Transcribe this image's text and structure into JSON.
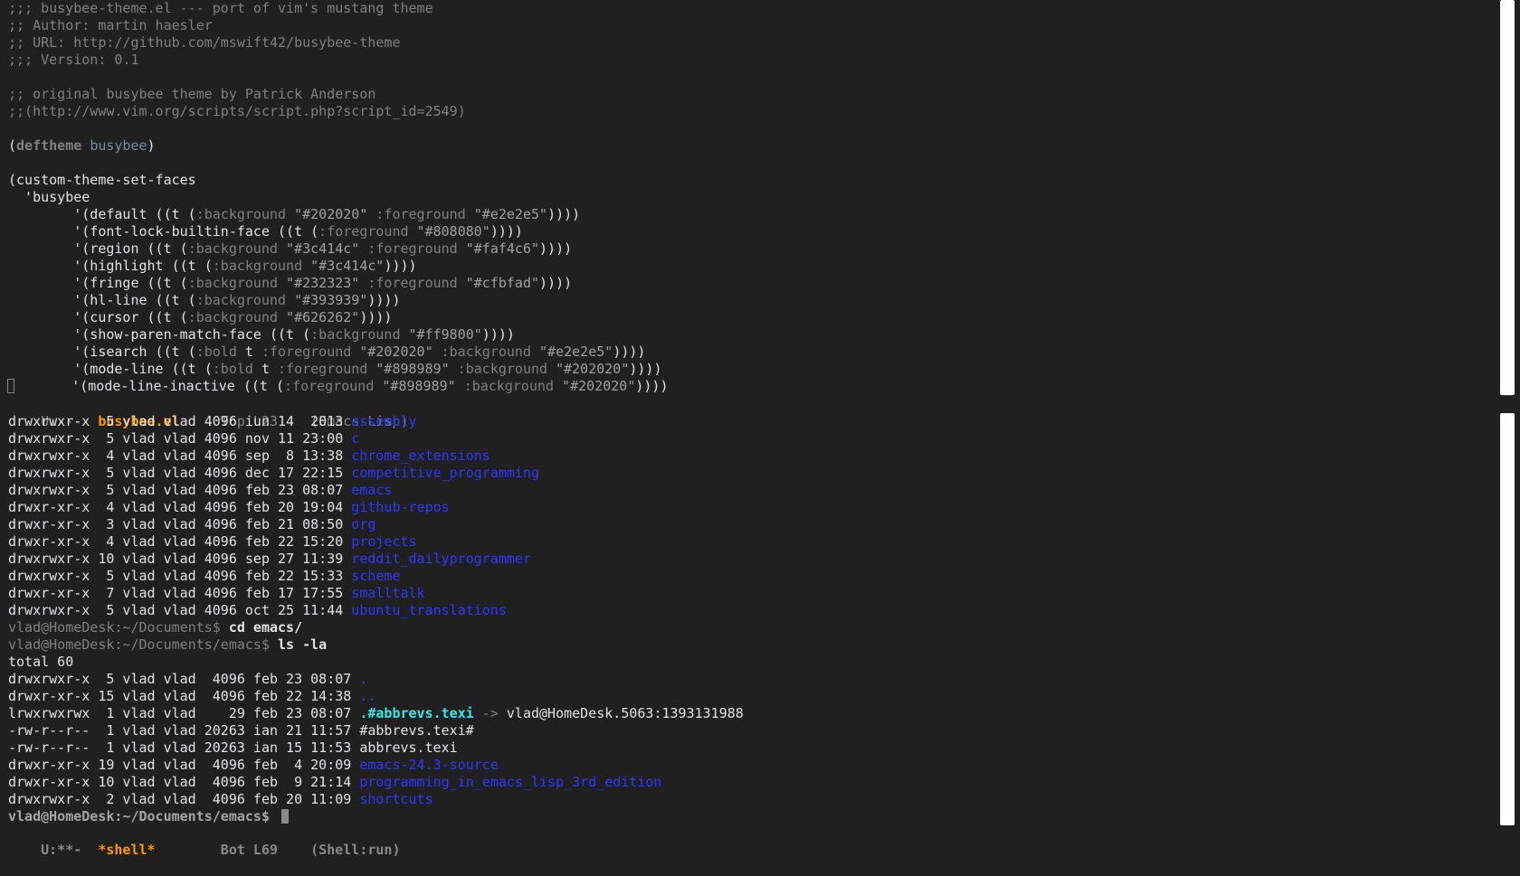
{
  "editor": {
    "lines": [
      [
        {
          "t": ";;; busybee-theme.el --- port of vim's mustang theme",
          "c": "c-comment"
        }
      ],
      [
        {
          "t": ";; Author: martin haesler",
          "c": "c-comment"
        }
      ],
      [
        {
          "t": ";; URL: http://github.com/mswift42/busybee-theme",
          "c": "c-comment"
        }
      ],
      [
        {
          "t": ";;; Version: 0.1",
          "c": "c-comment"
        }
      ],
      [
        {
          "t": ""
        }
      ],
      [
        {
          "t": ";; original busybee theme by Patrick Anderson",
          "c": "c-comment"
        }
      ],
      [
        {
          "t": ";;(http://www.vim.org/scripts/script.php?script_id=2549)",
          "c": "c-comment"
        }
      ],
      [
        {
          "t": ""
        }
      ],
      [
        {
          "t": "("
        },
        {
          "t": "deftheme",
          "c": "c-kw"
        },
        {
          "t": " "
        },
        {
          "t": "busybee",
          "c": "c-type"
        },
        {
          "t": ")"
        }
      ],
      [
        {
          "t": ""
        }
      ],
      [
        {
          "t": "(custom-theme-set-faces"
        }
      ],
      [
        {
          "t": "  'busybee"
        }
      ],
      [
        {
          "t": "        '(default ((t ("
        },
        {
          "t": ":background",
          "c": "c-key"
        },
        {
          "t": " "
        },
        {
          "t": "\"#202020\"",
          "c": "c-str"
        },
        {
          "t": " "
        },
        {
          "t": ":foreground",
          "c": "c-key"
        },
        {
          "t": " "
        },
        {
          "t": "\"#e2e2e5\"",
          "c": "c-str"
        },
        {
          "t": "))))"
        }
      ],
      [
        {
          "t": "        '(font-lock-builtin-face ((t ("
        },
        {
          "t": ":foreground",
          "c": "c-key"
        },
        {
          "t": " "
        },
        {
          "t": "\"#808080\"",
          "c": "c-str"
        },
        {
          "t": "))))"
        }
      ],
      [
        {
          "t": "        '(region ((t ("
        },
        {
          "t": ":background",
          "c": "c-key"
        },
        {
          "t": " "
        },
        {
          "t": "\"#3c414c\"",
          "c": "c-str"
        },
        {
          "t": " "
        },
        {
          "t": ":foreground",
          "c": "c-key"
        },
        {
          "t": " "
        },
        {
          "t": "\"#faf4c6\"",
          "c": "c-str"
        },
        {
          "t": "))))"
        }
      ],
      [
        {
          "t": "        '(highlight ((t ("
        },
        {
          "t": ":background",
          "c": "c-key"
        },
        {
          "t": " "
        },
        {
          "t": "\"#3c414c\"",
          "c": "c-str"
        },
        {
          "t": "))))"
        }
      ],
      [
        {
          "t": "        '(fringe ((t ("
        },
        {
          "t": ":background",
          "c": "c-key"
        },
        {
          "t": " "
        },
        {
          "t": "\"#232323\"",
          "c": "c-str"
        },
        {
          "t": " "
        },
        {
          "t": ":foreground",
          "c": "c-key"
        },
        {
          "t": " "
        },
        {
          "t": "\"#cfbfad\"",
          "c": "c-str"
        },
        {
          "t": "))))"
        }
      ],
      [
        {
          "t": "        '(hl-line ((t ("
        },
        {
          "t": ":background",
          "c": "c-key"
        },
        {
          "t": " "
        },
        {
          "t": "\"#393939\"",
          "c": "c-str"
        },
        {
          "t": "))))"
        }
      ],
      [
        {
          "t": "        '(cursor ((t ("
        },
        {
          "t": ":background",
          "c": "c-key"
        },
        {
          "t": " "
        },
        {
          "t": "\"#626262\"",
          "c": "c-str"
        },
        {
          "t": "))))"
        }
      ],
      [
        {
          "t": "        '(show-paren-match-face ((t ("
        },
        {
          "t": ":background",
          "c": "c-key"
        },
        {
          "t": " "
        },
        {
          "t": "\"#ff9800\"",
          "c": "c-str"
        },
        {
          "t": "))))"
        }
      ],
      [
        {
          "t": "        '(isearch ((t ("
        },
        {
          "t": ":bold",
          "c": "c-key"
        },
        {
          "t": " t "
        },
        {
          "t": ":foreground",
          "c": "c-key"
        },
        {
          "t": " "
        },
        {
          "t": "\"#202020\"",
          "c": "c-str"
        },
        {
          "t": " "
        },
        {
          "t": ":background",
          "c": "c-key"
        },
        {
          "t": " "
        },
        {
          "t": "\"#e2e2e5\"",
          "c": "c-str"
        },
        {
          "t": "))))"
        }
      ],
      [
        {
          "t": "        '(mode-line ((t ("
        },
        {
          "t": ":bold",
          "c": "c-key"
        },
        {
          "t": " t "
        },
        {
          "t": ":foreground",
          "c": "c-key"
        },
        {
          "t": " "
        },
        {
          "t": "\"#898989\"",
          "c": "c-str"
        },
        {
          "t": " "
        },
        {
          "t": ":background",
          "c": "c-key"
        },
        {
          "t": " "
        },
        {
          "t": "\"#202020\"",
          "c": "c-str"
        },
        {
          "t": "))))"
        }
      ],
      [
        {
          "t": "BOX",
          "c": "fringe"
        },
        {
          "t": "       '(mode-line-inactive ((t ("
        },
        {
          "t": ":foreground",
          "c": "c-key"
        },
        {
          "t": " "
        },
        {
          "t": "\"#898989\"",
          "c": "c-str"
        },
        {
          "t": " "
        },
        {
          "t": ":background",
          "c": "c-key"
        },
        {
          "t": " "
        },
        {
          "t": "\"#202020\"",
          "c": "c-str"
        },
        {
          "t": "))))"
        }
      ]
    ],
    "modeline": {
      "status": "U:---  ",
      "buffer": "busybee.el",
      "position": "     Top L23    ",
      "mode": "(Emacs-Lisp)"
    }
  },
  "shell": {
    "lines": [
      [
        {
          "t": "drwxrwxr-x  5 vlad vlad 4096 iun 14  2013 "
        },
        {
          "t": "assembly",
          "c": "c-dir"
        }
      ],
      [
        {
          "t": "drwxrwxr-x  5 vlad vlad 4096 nov 11 23:00 "
        },
        {
          "t": "c",
          "c": "c-dir"
        }
      ],
      [
        {
          "t": "drwxrwxr-x  4 vlad vlad 4096 sep  8 13:38 "
        },
        {
          "t": "chrome_extensions",
          "c": "c-dir"
        }
      ],
      [
        {
          "t": "drwxrwxr-x  5 vlad vlad 4096 dec 17 22:15 "
        },
        {
          "t": "competitive_programming",
          "c": "c-dir"
        }
      ],
      [
        {
          "t": "drwxrwxr-x  5 vlad vlad 4096 feb 23 08:07 "
        },
        {
          "t": "emacs",
          "c": "c-dir"
        }
      ],
      [
        {
          "t": "drwxr-xr-x  4 vlad vlad 4096 feb 20 19:04 "
        },
        {
          "t": "github-repos",
          "c": "c-dir"
        }
      ],
      [
        {
          "t": "drwxr-xr-x  3 vlad vlad 4096 feb 21 08:50 "
        },
        {
          "t": "org",
          "c": "c-dir"
        }
      ],
      [
        {
          "t": "drwxr-xr-x  4 vlad vlad 4096 feb 22 15:20 "
        },
        {
          "t": "projects",
          "c": "c-dir"
        }
      ],
      [
        {
          "t": "drwxrwxr-x 10 vlad vlad 4096 sep 27 11:39 "
        },
        {
          "t": "reddit_dailyprogrammer",
          "c": "c-dir"
        }
      ],
      [
        {
          "t": "drwxrwxr-x  5 vlad vlad 4096 feb 22 15:33 "
        },
        {
          "t": "scheme",
          "c": "c-dir"
        }
      ],
      [
        {
          "t": "drwxr-xr-x  7 vlad vlad 4096 feb 17 17:55 "
        },
        {
          "t": "smalltalk",
          "c": "c-dir"
        }
      ],
      [
        {
          "t": "drwxrwxr-x  5 vlad vlad 4096 oct 25 11:44 "
        },
        {
          "t": "ubuntu_translations",
          "c": "c-dir"
        }
      ],
      [
        {
          "t": "vlad@HomeDesk:~/Documents$ ",
          "c": "c-prompt"
        },
        {
          "t": "cd emacs/",
          "c": "c-cmd"
        }
      ],
      [
        {
          "t": "vlad@HomeDesk:~/Documents/emacs$ ",
          "c": "c-prompt"
        },
        {
          "t": "ls -la",
          "c": "c-cmd"
        }
      ],
      [
        {
          "t": "total 60"
        }
      ],
      [
        {
          "t": "drwxrwxr-x  5 vlad vlad  4096 feb 23 08:07 "
        },
        {
          "t": ".",
          "c": "c-dir"
        }
      ],
      [
        {
          "t": "drwxr-xr-x 15 vlad vlad  4096 feb 22 14:38 "
        },
        {
          "t": "..",
          "c": "c-dir"
        }
      ],
      [
        {
          "t": "lrwxrwxrwx  1 vlad vlad    29 feb 23 08:07 "
        },
        {
          "t": ".#abbrevs.texi",
          "c": "c-link"
        },
        {
          "t": " -> ",
          "c": "c-arrow"
        },
        {
          "t": "vlad@HomeDesk.5063:1393131988"
        }
      ],
      [
        {
          "t": "-rw-r--r--  1 vlad vlad 20263 ian 21 11:57 #abbrevs.texi#"
        }
      ],
      [
        {
          "t": "-rw-r--r--  1 vlad vlad 20263 ian 15 11:53 abbrevs.texi"
        }
      ],
      [
        {
          "t": "drwxr-xr-x 19 vlad vlad  4096 feb  4 20:09 "
        },
        {
          "t": "emacs-24.3-source",
          "c": "c-dir"
        }
      ],
      [
        {
          "t": "drwxr-xr-x 10 vlad vlad  4096 feb  9 21:14 "
        },
        {
          "t": "programming_in_emacs_lisp_3rd_edition",
          "c": "c-dir"
        }
      ],
      [
        {
          "t": "drwxrwxr-x  2 vlad vlad  4096 feb 20 11:09 "
        },
        {
          "t": "shortcuts",
          "c": "c-dir"
        }
      ],
      [
        {
          "t": "vlad@HomeDesk:~/Documents/emacs$ ",
          "c": "c-prompt-active"
        },
        {
          "t": "CURSOR",
          "c": "cursor"
        }
      ]
    ],
    "modeline": {
      "status": "U:**-  ",
      "buffer": "*shell*",
      "position": "        Bot L69    ",
      "mode": "(Shell:run)"
    }
  },
  "colors": {
    "background": "#202020",
    "foreground": "#e2e2e5",
    "comment": "#808080",
    "directory": "#2f37ff",
    "symlink": "#36e8e8",
    "modeline_buffer": "#ff9800",
    "modeline_fg": "#898989"
  }
}
